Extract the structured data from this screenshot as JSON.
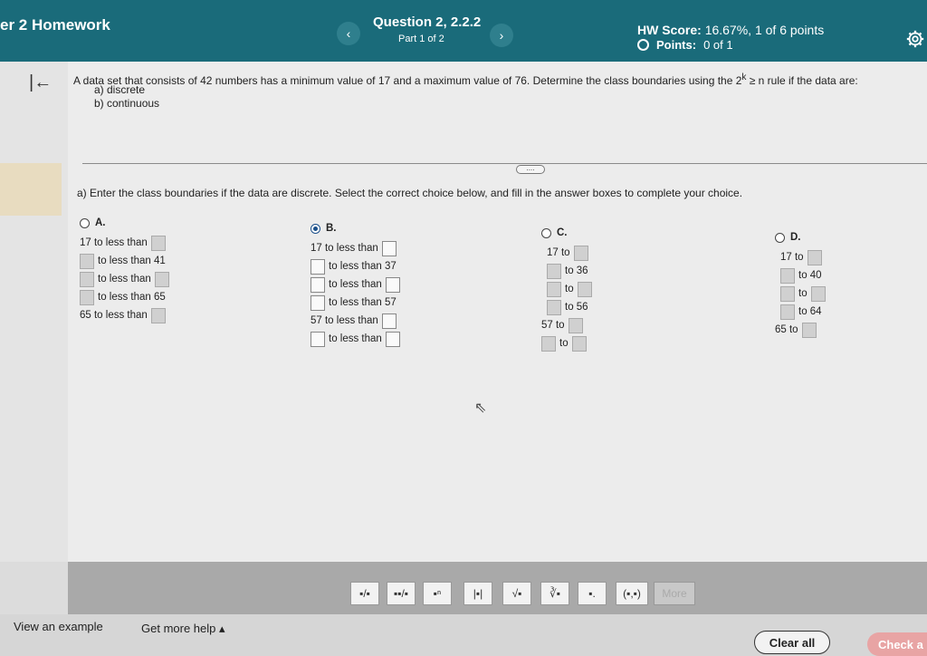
{
  "header": {
    "hw_title": "er 2 Homework",
    "question_title": "Question 2, 2.2.2",
    "question_part": "Part 1 of 2",
    "hw_score_label": "HW Score:",
    "hw_score_value": "16.67%, 1 of 6 points",
    "points_label": "Points:",
    "points_value": "0 of 1",
    "prev_icon": "chevron-left-icon",
    "next_icon": "chevron-right-icon",
    "settings_icon": "gear-icon"
  },
  "question": {
    "text": "A data set that consists of 42 numbers has a minimum value of 17 and a maximum value of 76. Determine the class boundaries using the 2",
    "superscript": "k",
    "text_after": " ≥ n rule if the data are:",
    "sub_a": "a) discrete",
    "sub_b": "b) continuous",
    "more_button": "....",
    "instruction": "a) Enter the class boundaries if the data are discrete. Select the correct choice below, and fill in the answer boxes to complete your choice."
  },
  "choices": {
    "a": {
      "label": "A.",
      "selected": false,
      "row1": "17 to less than",
      "row2": "to less than 41",
      "row3": "to less than",
      "row4": "to less than 65",
      "row5": "65 to less than"
    },
    "b": {
      "label": "B.",
      "selected": true,
      "row1": "17 to less than",
      "row2": "to less than 37",
      "row3": "to less than",
      "row4": "to less than 57",
      "row5": "57 to less than",
      "row6": "to less than"
    },
    "c": {
      "label": "C.",
      "selected": false,
      "row1": "17 to",
      "row2": "to 36",
      "row3": "to",
      "row4": "to 56",
      "row5": "57 to",
      "row6": "to"
    },
    "d": {
      "label": "D.",
      "selected": false,
      "row1": "17 to",
      "row2": "to 40",
      "row3": "to",
      "row4": "to 64",
      "row5": "65 to"
    }
  },
  "toolbar": {
    "tools": [
      "fraction-icon",
      "mixed-number-icon",
      "exponent-icon",
      "absolute-value-icon",
      "square-root-icon",
      "nth-root-icon",
      "subscript-icon",
      "ordered-pair-icon"
    ],
    "t4_label": "|▪|",
    "t5_label": "√▪",
    "t6_label": "∛▪",
    "t8_label": "(▪,▪)"
  },
  "footer": {
    "view_example": "View an example",
    "get_more_help": "Get more help ▴",
    "clear_all": "Clear all",
    "check_answer": "Check a"
  },
  "colors": {
    "header_bg": "#1a6b7a",
    "selected_radio": "#1a4f8a",
    "check_answer_bg": "#e8a4a4"
  }
}
